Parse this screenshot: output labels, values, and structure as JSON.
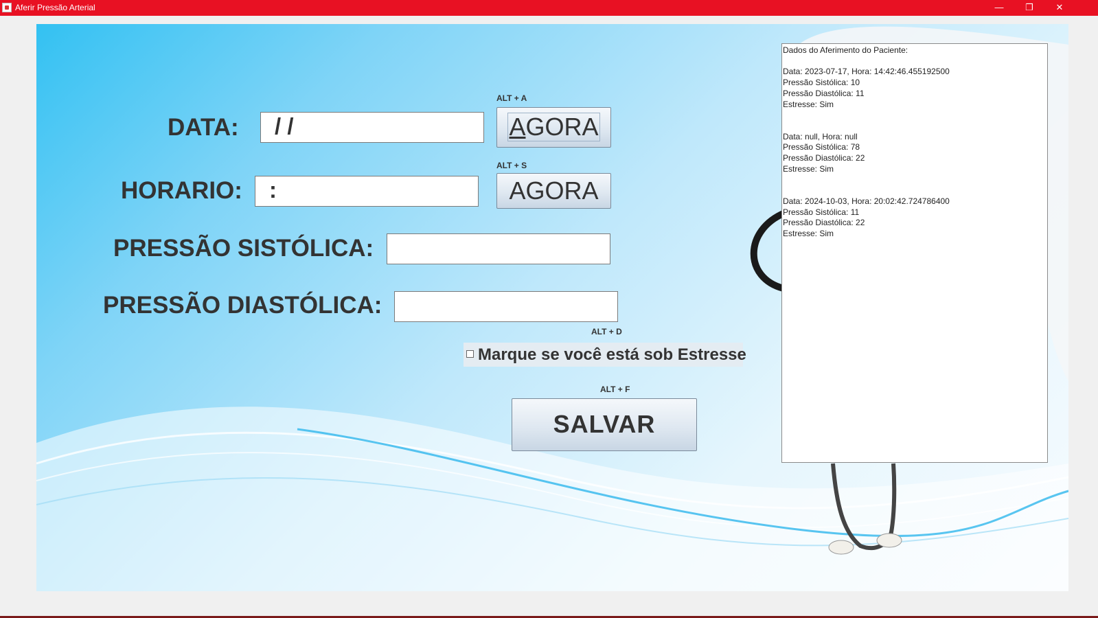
{
  "window": {
    "title": "Aferir Pressão Arterial",
    "minimize": "—",
    "restore": "❐",
    "close": "✕"
  },
  "form": {
    "data_label": "DATA:",
    "data_value": "  /  /",
    "horario_label": "HORARIO:",
    "horario_value": " :",
    "sistolica_label": "PRESSÃO SISTÓLICA:",
    "sistolica_value": "",
    "diastolica_label": "PRESSÃO DIASTÓLICA:",
    "diastolica_value": "",
    "agora_data_hint": "ALT + A",
    "agora_data_label": "AGORA",
    "agora_horario_hint": "ALT + S",
    "agora_horario_label": "AGORA",
    "estresse_hint": "ALT + D",
    "estresse_label": "Marque se você está sob Estresse",
    "estresse_checked": false,
    "salvar_hint": "ALT + F",
    "salvar_label": "SALVAR"
  },
  "log": {
    "text": "Dados do Aferimento do Paciente:\n\nData: 2023-07-17, Hora: 14:42:46.455192500\nPressão Sistólica: 10\nPressão Diastólica: 11\nEstresse: Sim\n\n\nData: null, Hora: null\nPressão Sistólica: 78\nPressão Diastólica: 22\nEstresse: Sim\n\n\nData: 2024-10-03, Hora: 20:02:42.724786400\nPressão Sistólica: 11\nPressão Diastólica: 22\nEstresse: Sim"
  },
  "colors": {
    "titlebar": "#e81123",
    "panel_accent": "#33c1f2"
  },
  "icons": [
    "java-app-icon",
    "minimize-icon",
    "restore-icon",
    "close-icon",
    "checkbox-icon"
  ]
}
